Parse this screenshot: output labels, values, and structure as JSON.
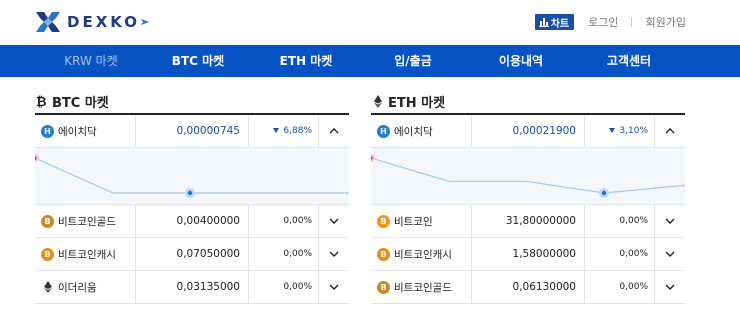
{
  "brand": {
    "name": "DEXKO"
  },
  "top_links": {
    "chart_label": "차트",
    "login": "로그인",
    "signup": "회원가입"
  },
  "nav": {
    "items": [
      {
        "label": "KRW 마켓",
        "active": true
      },
      {
        "label": "BTC 마켓",
        "active": false
      },
      {
        "label": "ETH 마켓",
        "active": false
      },
      {
        "label": "입/출금",
        "active": false
      },
      {
        "label": "이용내역",
        "active": false
      },
      {
        "label": "고객센터",
        "active": false
      }
    ]
  },
  "btc_market": {
    "title": "BTC 마켓",
    "rows": [
      {
        "name": "에이치닥",
        "icon": "hsr-icon",
        "price": "0,00000745",
        "change": "6,88%",
        "trend": "down",
        "expanded": true
      },
      {
        "name": "비트코인골드",
        "icon": "btg-icon",
        "price": "0,00400000",
        "change": "0,00%",
        "trend": "flat",
        "expanded": false
      },
      {
        "name": "비트코인캐시",
        "icon": "bch-icon",
        "price": "0,07050000",
        "change": "0,00%",
        "trend": "flat",
        "expanded": false
      },
      {
        "name": "이더리움",
        "icon": "eth-icon",
        "price": "0,03135000",
        "change": "0,00%",
        "trend": "flat",
        "expanded": false
      }
    ],
    "sparkline": [
      8.0,
      7.45,
      7.45,
      7.45,
      7.45
    ]
  },
  "eth_market": {
    "title": "ETH 마켓",
    "rows": [
      {
        "name": "에이치닥",
        "icon": "hsr-icon",
        "price": "0,00021900",
        "change": "3,10%",
        "trend": "down",
        "expanded": true
      },
      {
        "name": "비트코인",
        "icon": "btc-icon",
        "price": "31,80000000",
        "change": "0,00%",
        "trend": "flat",
        "expanded": false
      },
      {
        "name": "비트코인캐시",
        "icon": "bch-icon",
        "price": "1,58000000",
        "change": "0,00%",
        "trend": "flat",
        "expanded": false
      },
      {
        "name": "비트코인골드",
        "icon": "btg-icon",
        "price": "0,06130000",
        "change": "0,00%",
        "trend": "flat",
        "expanded": false
      }
    ],
    "sparkline": [
      22.6,
      22.0,
      22.0,
      21.7,
      21.9
    ]
  },
  "colors": {
    "primary": "#0753c4",
    "accent": "#1b4fa6",
    "nav_active": "#a7c2ec",
    "sparkline": "#9ccaf0"
  }
}
